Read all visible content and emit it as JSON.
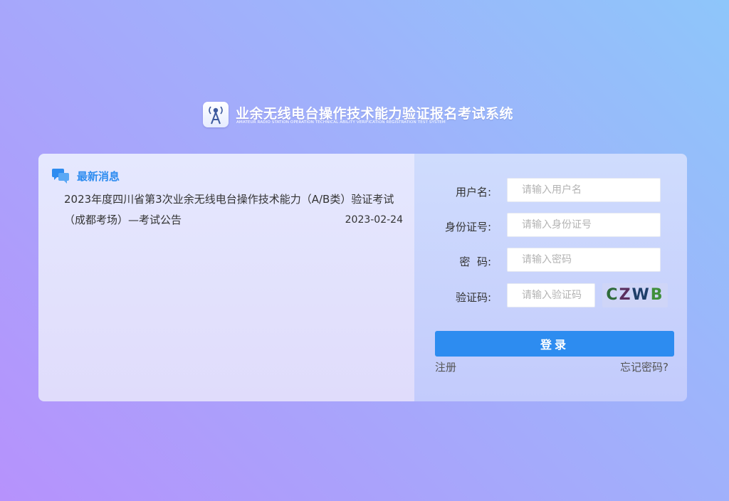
{
  "header": {
    "title": "业余无线电台操作技术能力验证报名考试系统",
    "subtitle": "AMATEUR RADIO STATION OPERATION TECHNICAL ABILITY VERIFICATION REGISTRATION TEST SYSTEM",
    "logo_icon": "radio-tower-icon"
  },
  "news": {
    "title": "最新消息",
    "icon": "chat-bubbles-icon",
    "items": [
      {
        "text": "2023年度四川省第3次业余无线电台操作技术能力（A/B类）验证考试（成都考场）—考试公告",
        "date": "2023-02-24"
      }
    ]
  },
  "login": {
    "username_label": "用户名:",
    "username_placeholder": "请输入用户名",
    "idcard_label": "身份证号:",
    "idcard_placeholder": "请输入身份证号",
    "password_label": "密  码:",
    "password_placeholder": "请输入密码",
    "captcha_label": "验证码:",
    "captcha_placeholder": "请输入验证码",
    "captcha_text": "CZWB",
    "login_button": "登录",
    "register_link": "注册",
    "forgot_link": "忘记密码?"
  },
  "colors": {
    "accent": "#2d8cf0",
    "captcha": [
      "#2f6b3a",
      "#5a2e5e",
      "#1f3f6a",
      "#3f8f3a"
    ]
  }
}
